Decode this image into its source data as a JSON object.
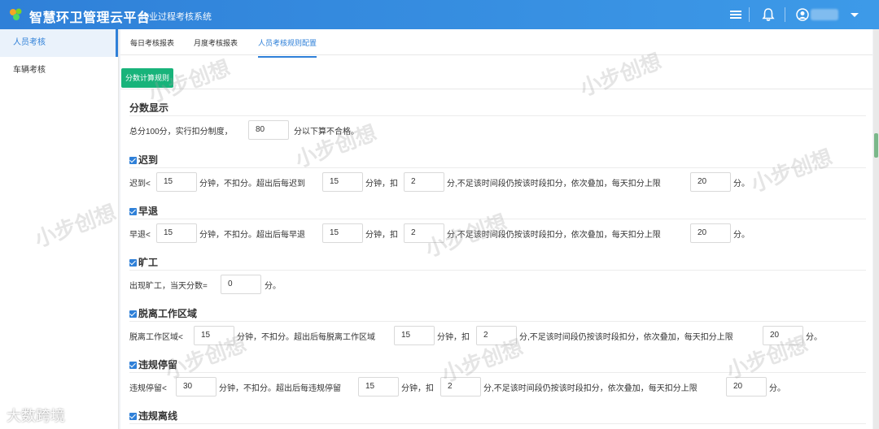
{
  "header": {
    "title": "智慧环卫管理云平台",
    "subtitle": "作业过程考核系统",
    "accent": "#2f80d8"
  },
  "sidebar": {
    "items": [
      {
        "label": "人员考核"
      },
      {
        "label": "车辆考核"
      }
    ]
  },
  "tabs": [
    {
      "label": "每日考核报表"
    },
    {
      "label": "月度考核报表"
    },
    {
      "label": "人员考核规则配置"
    }
  ],
  "action_button": "分数计算规则",
  "score_section": {
    "title": "分数显示",
    "text_before": "总分100分，实行扣分制度，",
    "value": "80",
    "text_after": "分以下算不合格。"
  },
  "late": {
    "title": "迟到",
    "t1": "迟到<",
    "v1": "15",
    "t2": "分钟，不扣分。超出后每迟到",
    "v2": "15",
    "t3": "分钟，扣",
    "v3": "2",
    "t4": "分,不足该时间段仍按该时段扣分，依次叠加，每天扣分上限",
    "v4": "20",
    "t5": "分。"
  },
  "early": {
    "title": "早退",
    "t1": "早退<",
    "v1": "15",
    "t2": "分钟，不扣分。超出后每早退",
    "v2": "15",
    "t3": "分钟，扣",
    "v3": "2",
    "t4": "分,不足该时间段仍按该时段扣分，依次叠加，每天扣分上限",
    "v4": "20",
    "t5": "分。"
  },
  "absent": {
    "title": "旷工",
    "t1": "出现旷工，当天分数=",
    "v1": "0",
    "t2": "分。"
  },
  "leave_area": {
    "title": "脱离工作区域",
    "t1": "脱离工作区域<",
    "v1": "15",
    "t2": "分钟，不扣分。超出后每脱离工作区域",
    "v2": "15",
    "t3": "分钟，扣",
    "v3": "2",
    "t4": "分,不足该时间段仍按该时段扣分，依次叠加，每天扣分上限",
    "v4": "20",
    "t5": "分。"
  },
  "illegal_stop": {
    "title": "违规停留",
    "t1": "违规停留<",
    "v1": "30",
    "t2": "分钟，不扣分。超出后每违规停留",
    "v2": "15",
    "t3": "分钟，扣",
    "v3": "2",
    "t4": "分,不足该时间段仍按该时段扣分，依次叠加，每天扣分上限",
    "v4": "20",
    "t5": "分。"
  },
  "offline": {
    "title": "违规离线"
  },
  "watermark": "小步创想",
  "corner_watermark": "大数跨境"
}
